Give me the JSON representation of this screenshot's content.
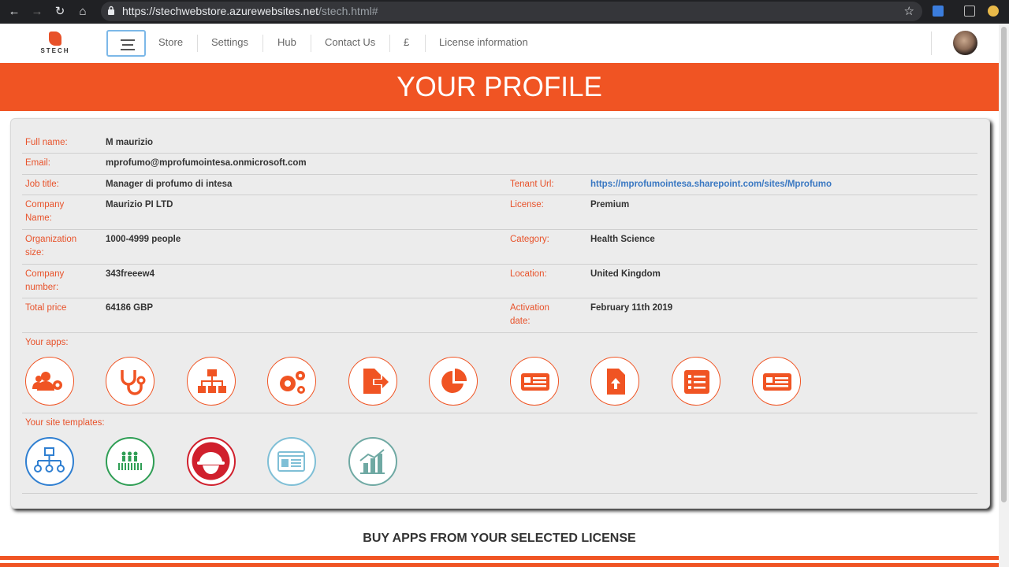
{
  "browser": {
    "url_host": "https://stechwebstore.azurewebsites.net",
    "url_path": "/stech.html#"
  },
  "logo": {
    "wordmark": "STECH"
  },
  "nav": {
    "items": [
      "Store",
      "Settings",
      "Hub",
      "Contact Us",
      "£",
      "License information"
    ]
  },
  "banner": {
    "title": "YOUR PROFILE"
  },
  "profile": {
    "full_name_label": "Full name:",
    "full_name": "M maurizio",
    "email_label": "Email:",
    "email": "mprofumo@mprofumointesa.onmicrosoft.com",
    "job_title_label": "Job title:",
    "job_title": "Manager di profumo di intesa",
    "tenant_url_label": "Tenant Url:",
    "tenant_url": "https://mprofumointesa.sharepoint.com/sites/Mprofumo",
    "company_name_label_1": "Company",
    "company_name_label_2": "Name:",
    "company_name": "Maurizio PI LTD",
    "license_label": "License:",
    "license": "Premium",
    "org_size_label_1": "Organization",
    "org_size_label_2": "size:",
    "org_size": "1000-4999 people",
    "category_label": "Category:",
    "category": "Health Science",
    "company_number_label_1": "Company",
    "company_number_label_2": "number:",
    "company_number": "343freeew4",
    "location_label": "Location:",
    "location": "United Kingdom",
    "total_price_label": "Total price",
    "total_price": "64186 GBP",
    "activation_label_1": "Activation",
    "activation_label_2": "date:",
    "activation_date": "February 11th 2019",
    "apps_label": "Your apps:",
    "templates_label": "Your site templates:"
  },
  "apps": [
    {
      "icon": "users-gear-icon"
    },
    {
      "icon": "stethoscope-icon"
    },
    {
      "icon": "org-chart-icon"
    },
    {
      "icon": "gears-icon"
    },
    {
      "icon": "file-export-icon"
    },
    {
      "icon": "pie-chart-icon"
    },
    {
      "icon": "newspaper-icon"
    },
    {
      "icon": "file-upload-icon"
    },
    {
      "icon": "list-icon"
    },
    {
      "icon": "newspaper-icon"
    }
  ],
  "templates": [
    {
      "icon": "hierarchy-icon",
      "color": "#2f7fd1"
    },
    {
      "icon": "people-icon",
      "color": "#2f9e55"
    },
    {
      "icon": "hard-hat-icon",
      "color": "#d0202d"
    },
    {
      "icon": "webpage-icon",
      "color": "#7fbfd6"
    },
    {
      "icon": "bar-chart-icon",
      "color": "#6fa9a3"
    }
  ],
  "footer": {
    "heading": "BUY APPS FROM YOUR SELECTED LICENSE"
  },
  "colors": {
    "accent": "#f05423",
    "link": "#3a78c2"
  }
}
